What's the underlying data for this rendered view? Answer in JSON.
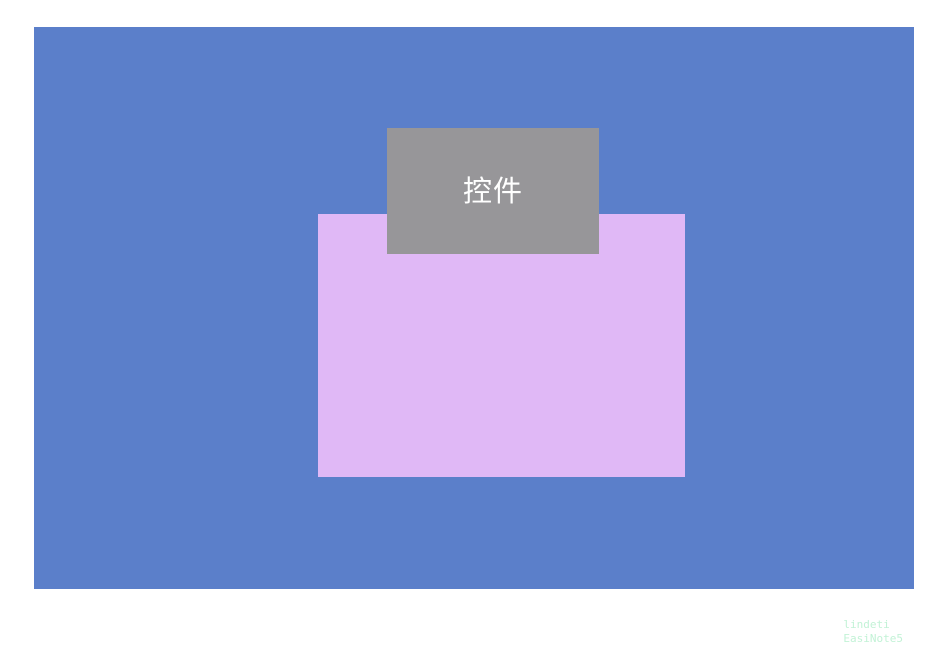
{
  "colors": {
    "container": "#5b7fca",
    "content_area": "#e0b8f6",
    "control": "#979699",
    "watermark": "#b8f0cf"
  },
  "control": {
    "label": "控件"
  },
  "watermark": {
    "line1": "lindeti",
    "line2": "EasiNote5"
  }
}
